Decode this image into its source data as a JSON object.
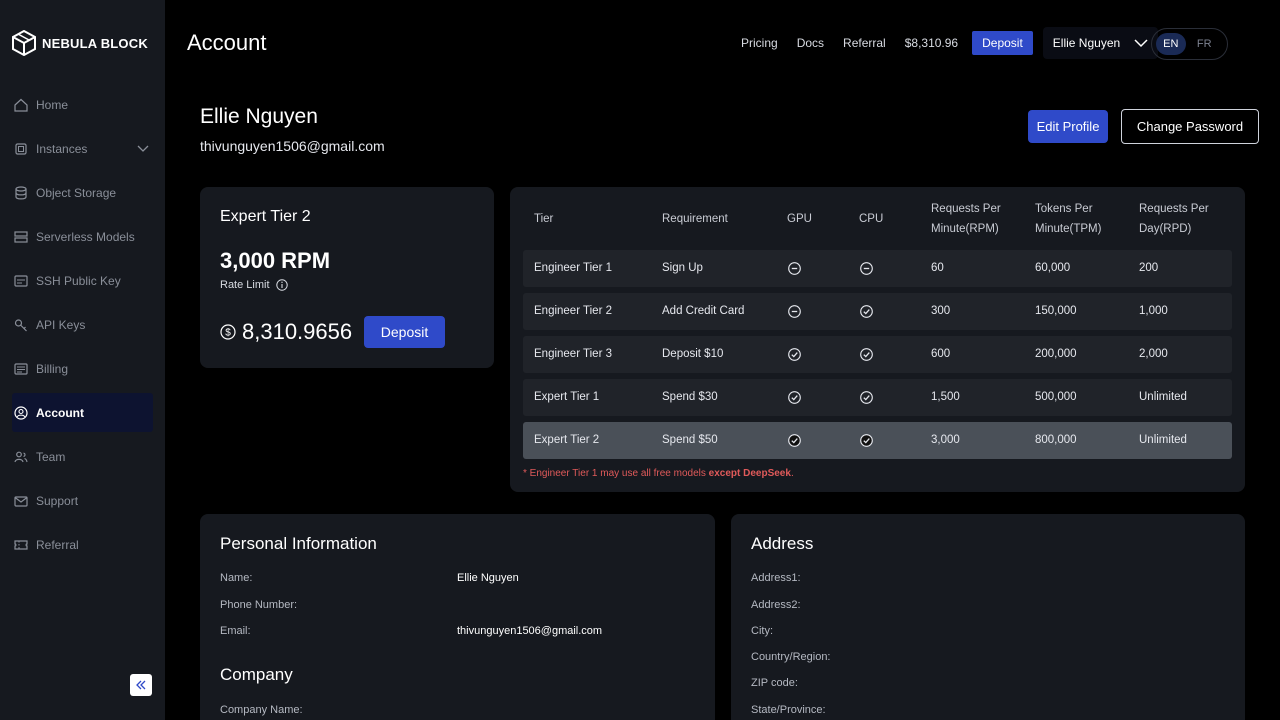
{
  "brand": {
    "name": "NEBULA BLOCK"
  },
  "sidebar": {
    "items": [
      {
        "label": "Home",
        "icon": "home-icon"
      },
      {
        "label": "Instances",
        "icon": "chip-icon"
      },
      {
        "label": "Object Storage",
        "icon": "database-icon"
      },
      {
        "label": "Serverless Models",
        "icon": "server-icon"
      },
      {
        "label": "SSH Public Key",
        "icon": "key-card-icon"
      },
      {
        "label": "API Keys",
        "icon": "key-icon"
      },
      {
        "label": "Billing",
        "icon": "billing-icon"
      },
      {
        "label": "Account",
        "icon": "user-circle-icon",
        "active": true
      },
      {
        "label": "Team",
        "icon": "team-icon"
      },
      {
        "label": "Support",
        "icon": "mail-icon"
      },
      {
        "label": "Referral",
        "icon": "ticket-icon"
      }
    ]
  },
  "header": {
    "title": "Account",
    "links": [
      "Pricing",
      "Docs",
      "Referral"
    ],
    "balance": "$8,310.96",
    "deposit_label": "Deposit",
    "user_name": "Ellie Nguyen",
    "languages": [
      "EN",
      "FR"
    ],
    "selected_language": "EN"
  },
  "profile": {
    "name": "Ellie Nguyen",
    "email": "thivunguyen1506@gmail.com",
    "edit_label": "Edit Profile",
    "change_password_label": "Change Password"
  },
  "tier_card": {
    "title": "Expert Tier 2",
    "rpm": "3,000 RPM",
    "rate_label": "Rate Limit",
    "balance": "8,310.9656",
    "deposit_label": "Deposit"
  },
  "tier_table": {
    "headers": {
      "tier": "Tier",
      "requirement": "Requirement",
      "gpu": "GPU",
      "cpu": "CPU",
      "rpm_1": "Requests Per",
      "rpm_2": "Minute(RPM)",
      "tpm_1": "Tokens Per",
      "tpm_2": "Minute(TPM)",
      "rpd_1": "Requests Per",
      "rpd_2": "Day(RPD)"
    },
    "rows": [
      {
        "tier": "Engineer Tier 1",
        "requirement": "Sign Up",
        "gpu": false,
        "cpu": false,
        "rpm": "60",
        "tpm": "60,000",
        "rpd": "200"
      },
      {
        "tier": "Engineer Tier 2",
        "requirement": "Add Credit Card",
        "gpu": false,
        "cpu": true,
        "rpm": "300",
        "tpm": "150,000",
        "rpd": "1,000"
      },
      {
        "tier": "Engineer Tier 3",
        "requirement": "Deposit $10",
        "gpu": true,
        "cpu": true,
        "rpm": "600",
        "tpm": "200,000",
        "rpd": "2,000"
      },
      {
        "tier": "Expert Tier 1",
        "requirement": "Spend $30",
        "gpu": true,
        "cpu": true,
        "rpm": "1,500",
        "tpm": "500,000",
        "rpd": "Unlimited"
      },
      {
        "tier": "Expert Tier 2",
        "requirement": "Spend $50",
        "gpu": true,
        "cpu": true,
        "rpm": "3,000",
        "tpm": "800,000",
        "rpd": "Unlimited",
        "current": true
      }
    ],
    "footnote_prefix": "* Engineer Tier 1 may use all free models",
    "footnote_bold": "except DeepSeek",
    "footnote_suffix": "."
  },
  "personal_info": {
    "title": "Personal Information",
    "name_label": "Name:",
    "name_value": "Ellie Nguyen",
    "phone_label": "Phone Number:",
    "email_label": "Email:",
    "email_value": "thivunguyen1506@gmail.com",
    "company_title": "Company",
    "company_name_label": "Company Name:"
  },
  "address": {
    "title": "Address",
    "address1_label": "Address1:",
    "address2_label": "Address2:",
    "city_label": "City:",
    "country_label": "Country/Region:",
    "zip_label": "ZIP code:",
    "state_label": "State/Province:"
  },
  "colors": {
    "accent": "#2f4ac9",
    "sidebar_bg": "#16191f",
    "active_nav_bg": "#0d1330",
    "footnote_red": "#e05a5a"
  }
}
